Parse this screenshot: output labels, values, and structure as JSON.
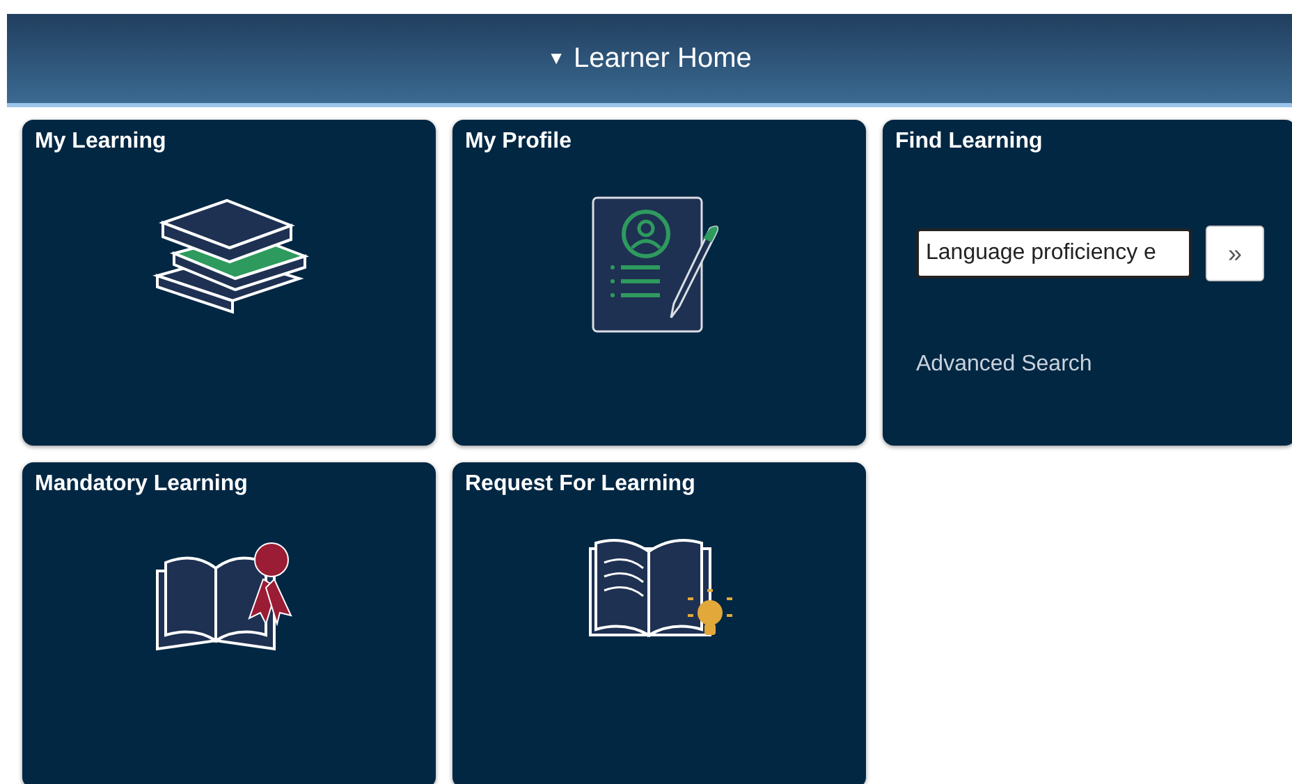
{
  "header": {
    "caret": "▼",
    "title": "Learner Home"
  },
  "tiles": [
    {
      "kind": "icon",
      "title": "My Learning"
    },
    {
      "kind": "icon",
      "title": "My Profile"
    },
    {
      "kind": "search",
      "title": "Find Learning",
      "value": "Language proficiency e",
      "button": "»",
      "link": "Advanced Search"
    },
    {
      "kind": "icon",
      "title": "Mandatory Learning"
    },
    {
      "kind": "icon",
      "title": "Request For Learning"
    }
  ]
}
